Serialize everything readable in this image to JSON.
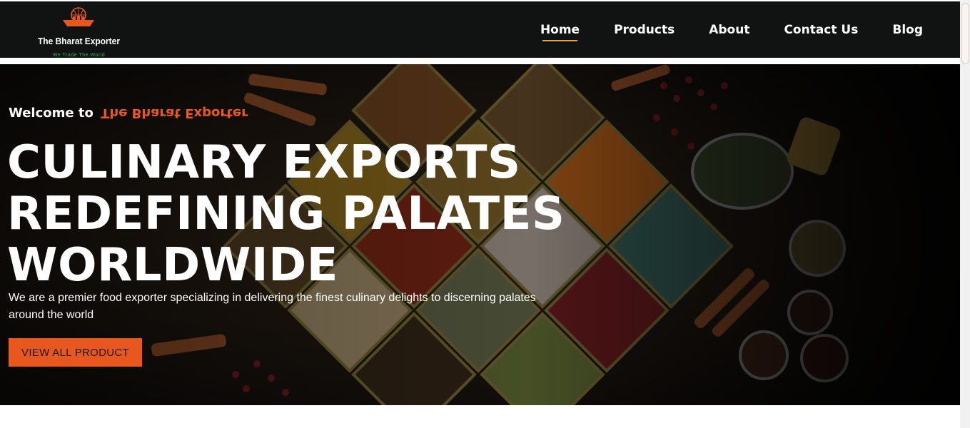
{
  "brand": {
    "name": "The Bharat Exporter",
    "tagline": "We Trade The World",
    "logo_icon": "ship-globe-icon",
    "accent_color": "#e8571d",
    "tagline_color": "#37b24d"
  },
  "nav": {
    "items": [
      {
        "label": "Home",
        "active": true
      },
      {
        "label": "Products",
        "active": false
      },
      {
        "label": "About",
        "active": false
      },
      {
        "label": "Contact Us",
        "active": false
      },
      {
        "label": "Blog",
        "active": false
      }
    ],
    "active_underline_color": "#e8a13b"
  },
  "hero": {
    "welcome_prefix": "Welcome to",
    "welcome_brand": "The Bharat Exporter",
    "headline_lines": [
      "CULINARY EXPORTS",
      "REDEFINING PALATES",
      "WORLDWIDE"
    ],
    "description": "We are a premier food exporter specializing in delivering the finest culinary delights to discerning palates around the world",
    "cta_label": "VIEW ALL PRODUCT",
    "background_image": "spices-in-bowls-photo"
  }
}
